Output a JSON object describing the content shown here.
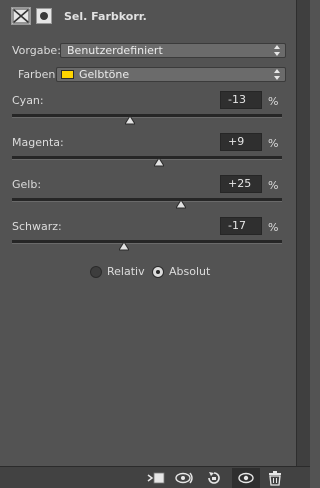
{
  "header": {
    "title": "Sel. Farbkorr.",
    "adjustment_icon": "selective-color-icon",
    "mask_icon": "layer-mask-icon"
  },
  "preset": {
    "label": "Vorgabe:",
    "value": "Benutzerdefiniert"
  },
  "colors": {
    "label": "Farben:",
    "value": "Gelbtöne",
    "swatch": "#ffd400"
  },
  "sliders": [
    {
      "label": "Cyan:",
      "value": "-13",
      "unit": "%",
      "level": -13
    },
    {
      "label": "Magenta:",
      "value": "+9",
      "unit": "%",
      "level": 9
    },
    {
      "label": "Gelb:",
      "value": "+25",
      "unit": "%",
      "level": 25
    },
    {
      "label": "Schwarz:",
      "value": "-17",
      "unit": "%",
      "level": -17
    }
  ],
  "method": {
    "options": [
      "Relativ",
      "Absolut"
    ],
    "selected": "Absolut"
  },
  "bottom_toolbar": {
    "icons": [
      "clip-to-layer-icon",
      "view-previous-state-icon",
      "reset-icon",
      "visibility-eye-icon",
      "trash-icon"
    ],
    "active": "visibility-eye-icon"
  }
}
